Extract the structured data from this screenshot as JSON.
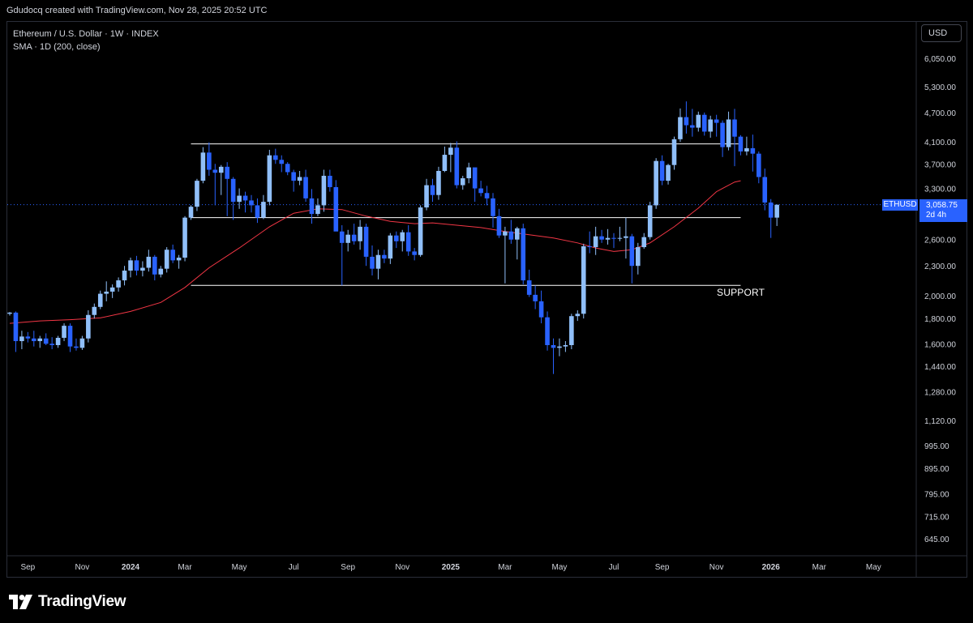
{
  "header": {
    "credit": "Gdudocq created with TradingView.com, Nov 28, 2025 20:52 UTC"
  },
  "legend": {
    "symbol_line": "Ethereum / U.S. Dollar · 1W · INDEX",
    "indicator_line": "SMA · 1D (200, close)"
  },
  "currency_button": "USD",
  "price_tag": {
    "symbol": "ETHUSD",
    "price": "3,058.75",
    "countdown": "2d 4h"
  },
  "annotation": {
    "support_label": "SUPPORT"
  },
  "brand": {
    "name": "TradingView"
  },
  "colors": {
    "up": "#90bff9",
    "down": "#2962ff",
    "sma": "#f23645",
    "lines": "#ffffff",
    "price_line": "#2962ff"
  },
  "chart_data": {
    "type": "candlestick",
    "timeframe": "1W",
    "scale": "log",
    "price_axis_labels": [
      "6,050.00",
      "5,300.00",
      "4,700.00",
      "4,100.00",
      "3,700.00",
      "3,300.00",
      "2,600.00",
      "2,300.00",
      "2,000.00",
      "1,800.00",
      "1,600.00",
      "1,440.00",
      "1,280.00",
      "1,120.00",
      "995.00",
      "895.00",
      "795.00",
      "715.00",
      "645.00"
    ],
    "price_axis_values": [
      6050,
      5300,
      4700,
      4100,
      3700,
      3300,
      2600,
      2300,
      2000,
      1800,
      1600,
      1440,
      1280,
      1120,
      995,
      895,
      795,
      715,
      645
    ],
    "time_axis_labels": [
      {
        "label": "Sep",
        "week": 3,
        "bold": false
      },
      {
        "label": "Nov",
        "week": 12,
        "bold": false
      },
      {
        "label": "2024",
        "week": 20,
        "bold": true
      },
      {
        "label": "Mar",
        "week": 29,
        "bold": false
      },
      {
        "label": "May",
        "week": 38,
        "bold": false
      },
      {
        "label": "Jul",
        "week": 47,
        "bold": false
      },
      {
        "label": "Sep",
        "week": 56,
        "bold": false
      },
      {
        "label": "Nov",
        "week": 65,
        "bold": false
      },
      {
        "label": "2025",
        "week": 73,
        "bold": true
      },
      {
        "label": "Mar",
        "week": 82,
        "bold": false
      },
      {
        "label": "May",
        "week": 91,
        "bold": false
      },
      {
        "label": "Jul",
        "week": 100,
        "bold": false
      },
      {
        "label": "Sep",
        "week": 108,
        "bold": false
      },
      {
        "label": "Nov",
        "week": 117,
        "bold": false
      },
      {
        "label": "2026",
        "week": 126,
        "bold": true
      },
      {
        "label": "Mar",
        "week": 134,
        "bold": false
      },
      {
        "label": "May",
        "week": 143,
        "bold": false
      }
    ],
    "candles": [
      [
        1840,
        1855,
        1825,
        1850
      ],
      [
        1850,
        1860,
        1540,
        1620
      ],
      [
        1620,
        1700,
        1560,
        1655
      ],
      [
        1655,
        1690,
        1610,
        1640
      ],
      [
        1640,
        1700,
        1580,
        1620
      ],
      [
        1620,
        1660,
        1570,
        1640
      ],
      [
        1640,
        1680,
        1590,
        1600
      ],
      [
        1600,
        1650,
        1560,
        1590
      ],
      [
        1590,
        1660,
        1570,
        1645
      ],
      [
        1645,
        1760,
        1620,
        1740
      ],
      [
        1740,
        1760,
        1540,
        1580
      ],
      [
        1580,
        1640,
        1550,
        1570
      ],
      [
        1570,
        1660,
        1555,
        1640
      ],
      [
        1640,
        1870,
        1610,
        1830
      ],
      [
        1830,
        1930,
        1800,
        1900
      ],
      [
        1900,
        2050,
        1880,
        2020
      ],
      [
        2020,
        2140,
        1950,
        2040
      ],
      [
        2040,
        2110,
        1980,
        2080
      ],
      [
        2080,
        2180,
        2040,
        2150
      ],
      [
        2150,
        2300,
        2100,
        2250
      ],
      [
        2250,
        2390,
        2180,
        2360
      ],
      [
        2360,
        2410,
        2200,
        2250
      ],
      [
        2250,
        2350,
        2190,
        2280
      ],
      [
        2280,
        2480,
        2240,
        2400
      ],
      [
        2400,
        2420,
        2150,
        2210
      ],
      [
        2210,
        2300,
        2180,
        2270
      ],
      [
        2270,
        2510,
        2230,
        2480
      ],
      [
        2480,
        2540,
        2330,
        2360
      ],
      [
        2360,
        2420,
        2270,
        2390
      ],
      [
        2390,
        2900,
        2350,
        2880
      ],
      [
        2880,
        3050,
        2850,
        3030
      ],
      [
        3030,
        3450,
        2970,
        3420
      ],
      [
        3420,
        4000,
        3380,
        3900
      ],
      [
        3900,
        4090,
        3500,
        3600
      ],
      [
        3600,
        3700,
        3050,
        3550
      ],
      [
        3550,
        3680,
        3200,
        3650
      ],
      [
        3650,
        3730,
        2900,
        3450
      ],
      [
        3450,
        3480,
        2850,
        3100
      ],
      [
        3100,
        3300,
        3000,
        3190
      ],
      [
        3190,
        3250,
        2950,
        3120
      ],
      [
        3120,
        3200,
        2950,
        3050
      ],
      [
        3050,
        3150,
        2810,
        2880
      ],
      [
        2880,
        3200,
        2860,
        3100
      ],
      [
        3100,
        3950,
        3050,
        3850
      ],
      [
        3850,
        3970,
        3700,
        3770
      ],
      [
        3770,
        3850,
        3560,
        3700
      ],
      [
        3700,
        3730,
        3510,
        3560
      ],
      [
        3560,
        3600,
        3250,
        3420
      ],
      [
        3420,
        3580,
        3350,
        3480
      ],
      [
        3480,
        3600,
        3100,
        3150
      ],
      [
        3150,
        3290,
        2800,
        2930
      ],
      [
        2930,
        3150,
        2900,
        3050
      ],
      [
        3050,
        3600,
        2960,
        3500
      ],
      [
        3500,
        3600,
        3250,
        3320
      ],
      [
        3320,
        3430,
        2780,
        2700
      ],
      [
        2700,
        2780,
        2100,
        2560
      ],
      [
        2560,
        2720,
        2460,
        2660
      ],
      [
        2660,
        2800,
        2540,
        2580
      ],
      [
        2580,
        2850,
        2480,
        2760
      ],
      [
        2760,
        2800,
        2300,
        2400
      ],
      [
        2400,
        2530,
        2200,
        2270
      ],
      [
        2270,
        2480,
        2160,
        2420
      ],
      [
        2420,
        2480,
        2330,
        2380
      ],
      [
        2380,
        2680,
        2320,
        2650
      ],
      [
        2650,
        2700,
        2500,
        2580
      ],
      [
        2580,
        2720,
        2460,
        2690
      ],
      [
        2690,
        2780,
        2410,
        2460
      ],
      [
        2460,
        2500,
        2360,
        2420
      ],
      [
        2420,
        3050,
        2400,
        3020
      ],
      [
        3020,
        3450,
        2980,
        3350
      ],
      [
        3350,
        3450,
        3100,
        3200
      ],
      [
        3200,
        3650,
        3130,
        3580
      ],
      [
        3580,
        4010,
        3560,
        3860
      ],
      [
        3860,
        4080,
        3560,
        3990
      ],
      [
        3990,
        4110,
        3300,
        3350
      ],
      [
        3350,
        3500,
        3280,
        3460
      ],
      [
        3460,
        3720,
        3380,
        3640
      ],
      [
        3640,
        3620,
        3100,
        3300
      ],
      [
        3300,
        3420,
        3180,
        3230
      ],
      [
        3230,
        3340,
        3050,
        3150
      ],
      [
        3150,
        3230,
        2750,
        2900
      ],
      [
        2900,
        3000,
        2620,
        2650
      ],
      [
        2650,
        2760,
        2120,
        2700
      ],
      [
        2700,
        2850,
        2550,
        2600
      ],
      [
        2600,
        2760,
        2370,
        2740
      ],
      [
        2740,
        2800,
        2110,
        2150
      ],
      [
        2150,
        2260,
        1990,
        2010
      ],
      [
        2010,
        2100,
        1880,
        1950
      ],
      [
        1950,
        2050,
        1760,
        1810
      ],
      [
        1810,
        1860,
        1550,
        1590
      ],
      [
        1590,
        1640,
        1390,
        1570
      ],
      [
        1570,
        1640,
        1510,
        1580
      ],
      [
        1580,
        1620,
        1540,
        1590
      ],
      [
        1590,
        1840,
        1560,
        1820
      ],
      [
        1820,
        1870,
        1780,
        1840
      ],
      [
        1840,
        2550,
        1800,
        2520
      ],
      [
        2520,
        2700,
        2440,
        2510
      ],
      [
        2510,
        2760,
        2420,
        2640
      ],
      [
        2640,
        2720,
        2560,
        2600
      ],
      [
        2600,
        2730,
        2540,
        2620
      ],
      [
        2620,
        2680,
        2500,
        2610
      ],
      [
        2610,
        2760,
        2580,
        2620
      ],
      [
        2620,
        2880,
        2380,
        2640
      ],
      [
        2640,
        2670,
        2120,
        2300
      ],
      [
        2300,
        2560,
        2210,
        2510
      ],
      [
        2510,
        2680,
        2490,
        2630
      ],
      [
        2630,
        3100,
        2600,
        3050
      ],
      [
        3050,
        3800,
        3000,
        3750
      ],
      [
        3750,
        3850,
        3350,
        3420
      ],
      [
        3420,
        3700,
        3360,
        3680
      ],
      [
        3680,
        4200,
        3600,
        4150
      ],
      [
        4150,
        4790,
        4100,
        4600
      ],
      [
        4600,
        4950,
        4260,
        4430
      ],
      [
        4430,
        4780,
        4200,
        4380
      ],
      [
        4380,
        4720,
        4300,
        4650
      ],
      [
        4650,
        4700,
        4220,
        4300
      ],
      [
        4300,
        4630,
        4180,
        4550
      ],
      [
        4550,
        4650,
        4200,
        4480
      ],
      [
        4480,
        4530,
        3820,
        4000
      ],
      [
        4000,
        4720,
        3940,
        4550
      ],
      [
        4550,
        4780,
        3660,
        4200
      ],
      [
        4200,
        4230,
        3850,
        3920
      ],
      [
        3920,
        4200,
        3850,
        3980
      ],
      [
        3980,
        4240,
        3570,
        3880
      ],
      [
        3880,
        3920,
        3380,
        3480
      ],
      [
        3480,
        3620,
        2980,
        3090
      ],
      [
        3090,
        3140,
        2620,
        2880
      ],
      [
        2880,
        3060,
        2770,
        3058.75
      ]
    ],
    "sma_200": {
      "name": "SMA (200, close)",
      "points": [
        [
          0,
          1760
        ],
        [
          5,
          1780
        ],
        [
          10,
          1790
        ],
        [
          15,
          1805
        ],
        [
          20,
          1860
        ],
        [
          25,
          1940
        ],
        [
          29,
          2080
        ],
        [
          33,
          2280
        ],
        [
          38,
          2500
        ],
        [
          43,
          2760
        ],
        [
          47,
          2940
        ],
        [
          51,
          3000
        ],
        [
          55,
          2990
        ],
        [
          59,
          2900
        ],
        [
          63,
          2830
        ],
        [
          67,
          2800
        ],
        [
          70,
          2810
        ],
        [
          74,
          2780
        ],
        [
          78,
          2750
        ],
        [
          82,
          2700
        ],
        [
          86,
          2660
        ],
        [
          90,
          2620
        ],
        [
          94,
          2560
        ],
        [
          97,
          2500
        ],
        [
          100,
          2460
        ],
        [
          103,
          2480
        ],
        [
          106,
          2560
        ],
        [
          110,
          2760
        ],
        [
          114,
          3010
        ],
        [
          117,
          3250
        ],
        [
          120,
          3400
        ],
        [
          121,
          3420
        ]
      ]
    },
    "resistance": {
      "price": 4060,
      "from_week": 30,
      "to_week": 121
    },
    "support": {
      "price": 2100,
      "from_week": 30,
      "to_week": 121,
      "label": "SUPPORT"
    },
    "mid_level": {
      "price": 2880,
      "from_week": 30,
      "to_week": 121
    },
    "current_price": 3058.75
  }
}
